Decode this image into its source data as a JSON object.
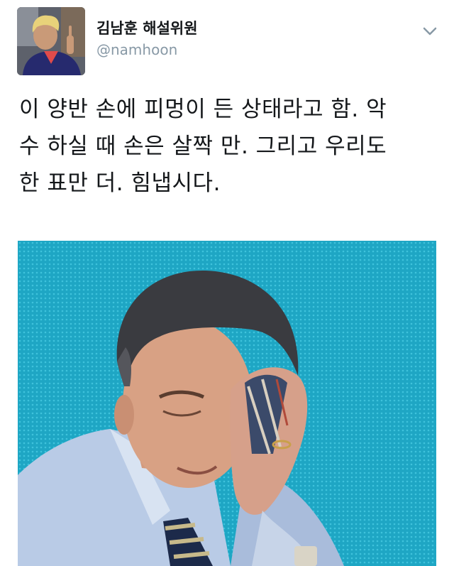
{
  "tweet": {
    "display_name": "김남훈 해설위원",
    "handle": "@namhoon",
    "text": "이 양반 손에 피멍이 든 상태라고 함. 악\n수 하실 때 손은 살짝 만. 그리고 우리도\n한 표만 더. 힘냅시다.",
    "menu_icon": "chevron-down-icon",
    "avatar_icon": "avatar",
    "media": "photo"
  },
  "colors": {
    "text": "#14171a",
    "handle": "#8899a6",
    "media_background": "#1fa3c2"
  }
}
